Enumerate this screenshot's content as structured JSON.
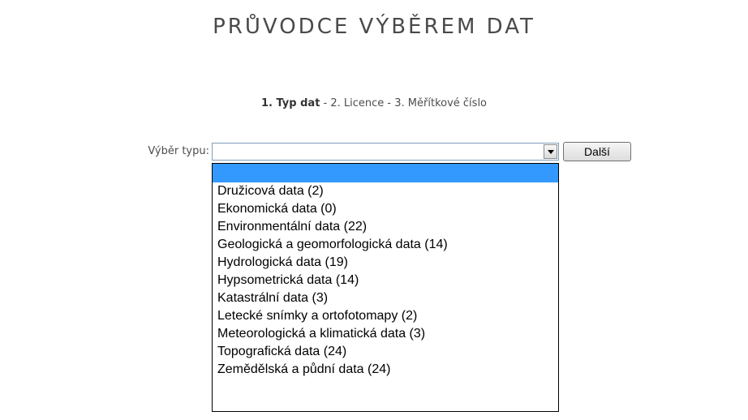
{
  "page": {
    "title": "PRŮVODCE VÝBĚREM DAT"
  },
  "steps": {
    "step1": "1. Typ dat",
    "sep1": " - ",
    "step2": "2. Licence",
    "sep2": " - ",
    "step3": "3. Měřítkové číslo"
  },
  "form": {
    "select_label": "Výběr typu:",
    "select_value": "",
    "next_button": "Další"
  },
  "dropdown": {
    "options": [
      "",
      "Družicová data (2)",
      "Ekonomická data (0)",
      "Environmentální data (22)",
      "Geologická a geomorfologická data (14)",
      "Hydrologická data (19)",
      "Hypsometrická data (14)",
      "Katastrální data (3)",
      "Letecké snímky a ortofotomapy (2)",
      "Meteorologická a klimatická data (3)",
      "Topografická data (24)",
      "Zemědělská a půdní data (24)"
    ],
    "highlighted_index": 0
  },
  "colors": {
    "highlight": "#3399ff",
    "text": "#333333"
  }
}
